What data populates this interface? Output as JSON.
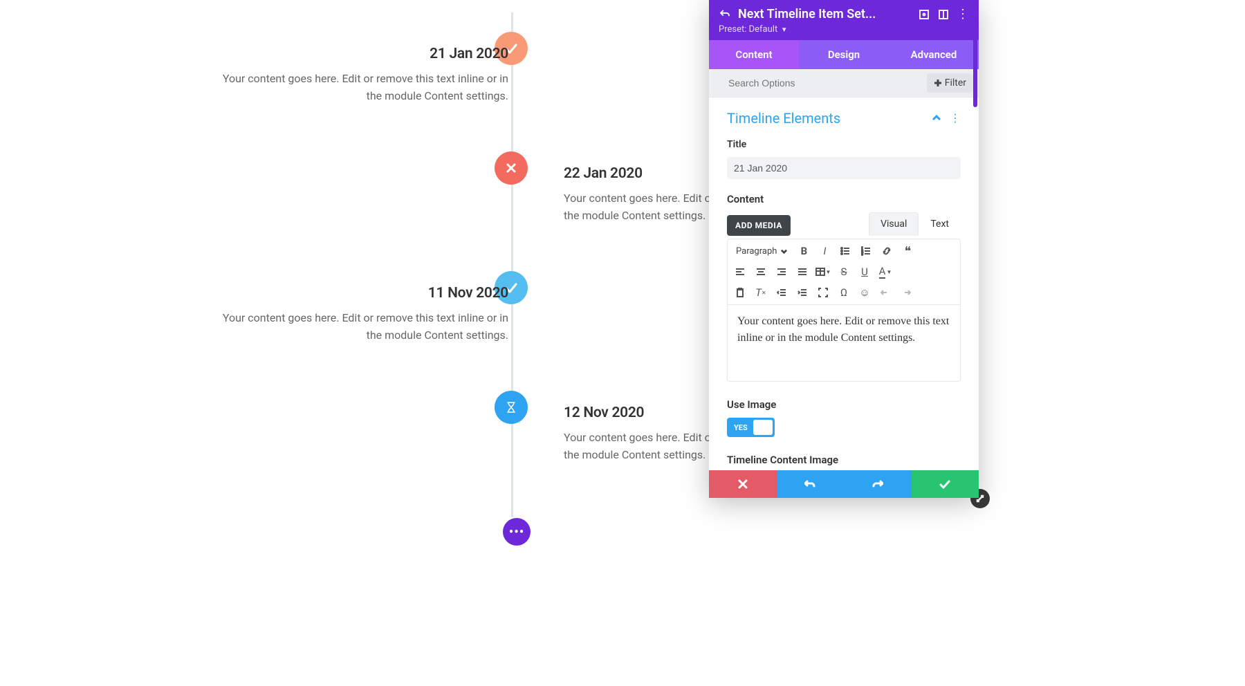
{
  "timeline": {
    "items": [
      {
        "title": "21 Jan 2020",
        "body": "Your content goes here. Edit or remove this text inline or in the module Content settings.",
        "side": "left",
        "marker": {
          "color": "#f99a76",
          "icon": "check"
        }
      },
      {
        "title": "22 Jan 2020",
        "body": "Your content goes here. Edit or remove this text inline or in the module Content settings.",
        "side": "right",
        "marker": {
          "color": "#f26b5e",
          "icon": "x"
        }
      },
      {
        "title": "11 Nov 2020",
        "body": "Your content goes here. Edit or remove this text inline or in the module Content settings.",
        "side": "left",
        "marker": {
          "color": "#55bdef",
          "icon": "check"
        }
      },
      {
        "title": "12 Nov 2020",
        "body": "Your content goes here. Edit or remove this text inline or in the module Content settings.",
        "side": "right",
        "marker": {
          "color": "#2ea3f2",
          "icon": "hourglass"
        }
      }
    ]
  },
  "panel": {
    "title": "Next Timeline Item Set...",
    "preset_label": "Preset: Default",
    "tabs": {
      "content": "Content",
      "design": "Design",
      "advanced": "Advanced",
      "active": "content"
    },
    "search_placeholder": "Search Options",
    "filter_label": "Filter",
    "section_title": "Timeline Elements",
    "fields": {
      "title_label": "Title",
      "title_value": "21 Jan 2020",
      "content_label": "Content",
      "add_media": "ADD MEDIA",
      "editor_tabs": {
        "visual": "Visual",
        "text": "Text",
        "active": "visual"
      },
      "format_label": "Paragraph",
      "content_value": "Your content goes here. Edit or remove this text inline or in the module Content settings.",
      "use_image_label": "Use Image",
      "use_image_value": "YES",
      "tci_label": "Timeline Content Image"
    }
  }
}
